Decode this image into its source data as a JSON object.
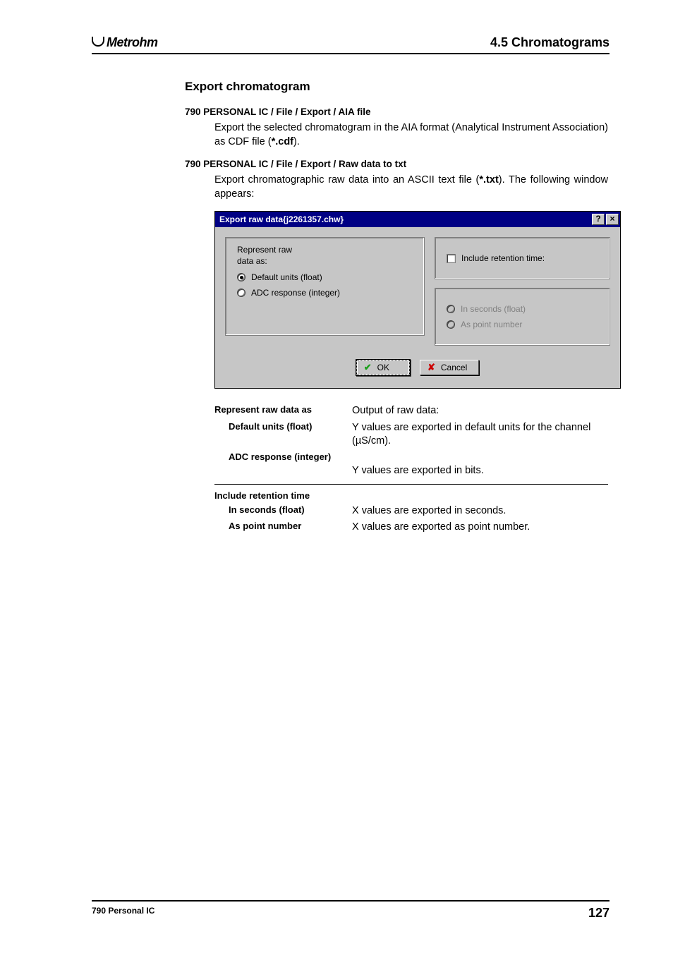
{
  "header": {
    "logo_text": "Metrohm",
    "section": "4.5  Chromatograms"
  },
  "headings": {
    "export": "Export chromatogram"
  },
  "aia": {
    "path": "790 PERSONAL IC / File / Export / AIA file",
    "text_1": "Export the selected chromatogram in the AIA format (Analytical Instrument Association) as CDF file (",
    "ext": "*.cdf",
    "text_2": ")."
  },
  "txt": {
    "path": "790 PERSONAL IC / File / Export / Raw data to txt",
    "text_1": "Export chromatographic raw data into an ASCII text file (",
    "ext": "*.txt",
    "text_2": "). The following window appears:"
  },
  "dialog": {
    "title": "Export raw data{j2261357.chw}",
    "represent_label_1": "Represent raw",
    "represent_label_2": "data as:",
    "radio_default": "Default units (float)",
    "radio_adc": "ADC response (integer)",
    "check_retention": "Include retention time:",
    "radio_seconds": "In seconds (float)",
    "radio_pointnum": "As point number",
    "ok": "OK",
    "cancel": "Cancel"
  },
  "defs": {
    "represent_as": "Represent raw data as",
    "represent_as_desc": "Output of raw data:",
    "default_units": "Default units (float)",
    "default_units_desc": "Y values are exported in default units for the channel (µS/cm).",
    "adc": "ADC response (integer)",
    "adc_desc": "Y values are exported in bits.",
    "include_rt": "Include retention time",
    "in_seconds": "In seconds (float)",
    "in_seconds_desc": "X values are exported in seconds.",
    "as_point": "As point number",
    "as_point_desc": "X values are exported as point number."
  },
  "footer": {
    "left": "790 Personal IC",
    "page": "127"
  }
}
